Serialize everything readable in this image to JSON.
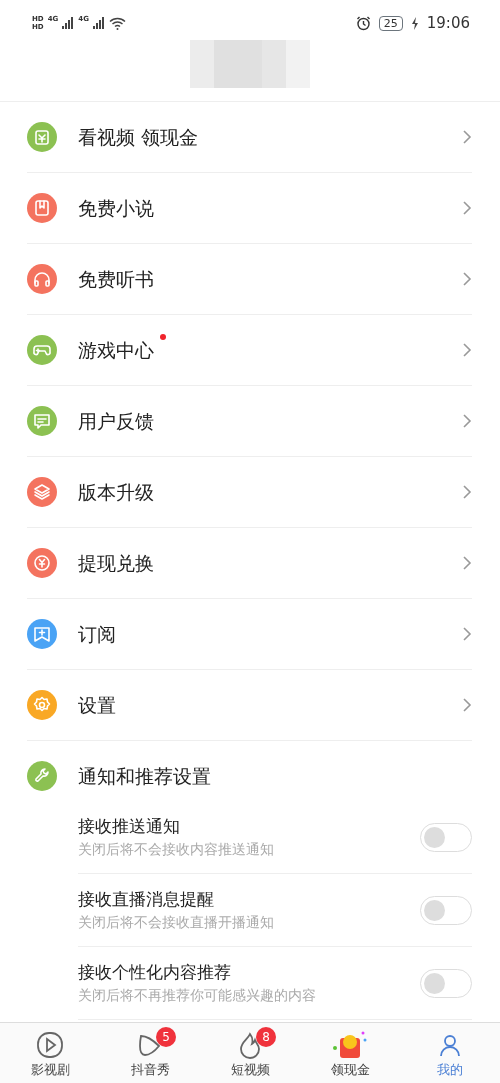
{
  "status_bar": {
    "sim_labels": [
      "HD",
      "HD"
    ],
    "network_labels": [
      "4G",
      "4G"
    ],
    "battery": "25",
    "time": "19:06"
  },
  "menu": [
    {
      "label": "看视频 领现金",
      "color": "#8cc152",
      "dot": false
    },
    {
      "label": "免费小说",
      "color": "#f4735f",
      "dot": false
    },
    {
      "label": "免费听书",
      "color": "#f4735f",
      "dot": false
    },
    {
      "label": "游戏中心",
      "color": "#8cc152",
      "dot": true
    },
    {
      "label": "用户反馈",
      "color": "#8cc152",
      "dot": false
    },
    {
      "label": "版本升级",
      "color": "#f4735f",
      "dot": false
    },
    {
      "label": "提现兑换",
      "color": "#f4735f",
      "dot": false
    },
    {
      "label": "订阅",
      "color": "#4aa3f5",
      "dot": false
    },
    {
      "label": "设置",
      "color": "#f9a825",
      "dot": false
    }
  ],
  "notifications": {
    "title": "通知和推荐设置",
    "color": "#8cc152",
    "settings": [
      {
        "label": "接收推送通知",
        "hint": "关闭后将不会接收内容推送通知",
        "on": false
      },
      {
        "label": "接收直播消息提醒",
        "hint": "关闭后将不会接收直播开播通知",
        "on": false
      },
      {
        "label": "接收个性化内容推荐",
        "hint": "关闭后将不再推荐你可能感兴趣的内容",
        "on": false
      }
    ]
  },
  "tab_bar": [
    {
      "label": "影视剧",
      "selected": false
    },
    {
      "label": "抖音秀",
      "badge": "5",
      "selected": false
    },
    {
      "label": "短视频",
      "badge": "8",
      "selected": false
    },
    {
      "label": "领现金",
      "selected": false
    },
    {
      "label": "我的",
      "selected": true
    }
  ]
}
